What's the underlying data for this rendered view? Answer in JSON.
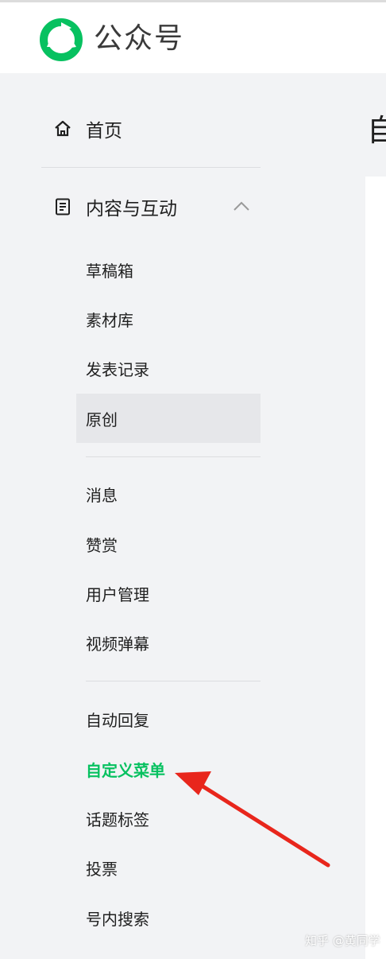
{
  "header": {
    "app_title": "公众号",
    "logo_icon": "wechat-official-accounts-logo"
  },
  "page": {
    "title_fragment": "自"
  },
  "sidebar": {
    "home": {
      "label": "首页",
      "icon": "home-icon"
    },
    "content_group": {
      "label": "内容与互动",
      "icon": "document-icon",
      "expanded": true
    },
    "items": [
      {
        "label": "草稿箱"
      },
      {
        "label": "素材库"
      },
      {
        "label": "发表记录"
      },
      {
        "label": "原创",
        "state": "hovered"
      },
      {
        "label": "消息"
      },
      {
        "label": "赞赏"
      },
      {
        "label": "用户管理"
      },
      {
        "label": "视频弹幕"
      },
      {
        "label": "自动回复"
      },
      {
        "label": "自定义菜单",
        "state": "active"
      },
      {
        "label": "话题标签"
      },
      {
        "label": "投票"
      },
      {
        "label": "号内搜索"
      }
    ]
  },
  "annotation": {
    "arrow_color": "#e8261c",
    "arrow_icon": "red-arrow-annotation"
  },
  "watermark": {
    "text": "知乎 @黄同学"
  },
  "colors": {
    "accent": "#07c160",
    "sidebar_bg": "#f2f3f5",
    "hover_bg": "#e6e7ea"
  }
}
